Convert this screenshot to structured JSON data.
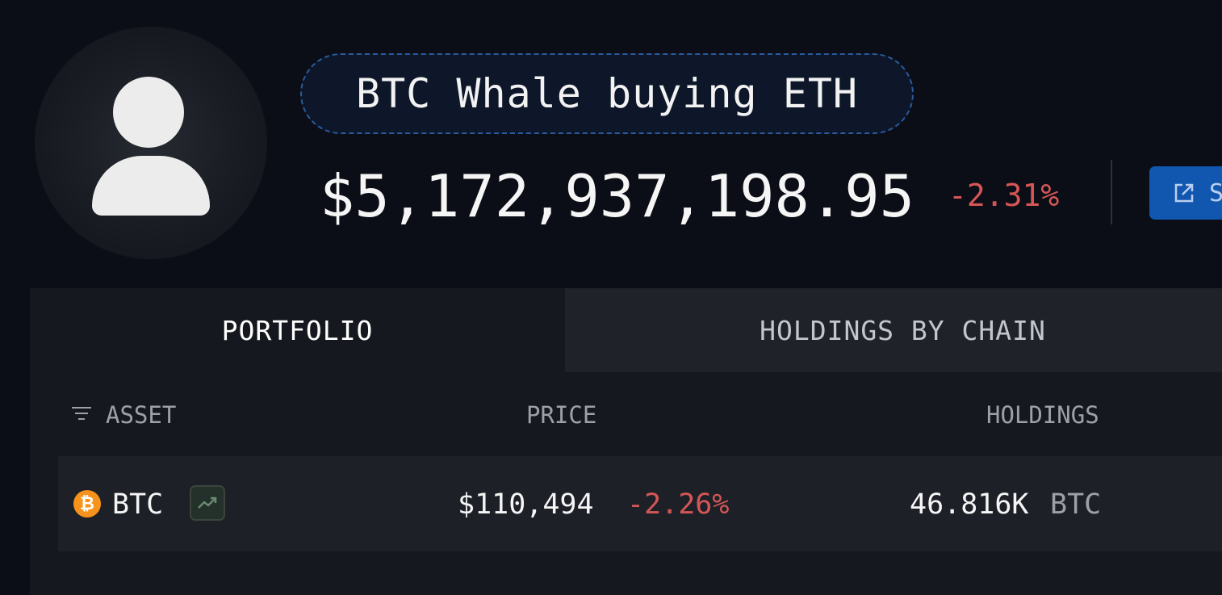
{
  "wallet": {
    "name": "BTC Whale buying ETH",
    "balance": "$5,172,937,198.95",
    "change": "-2.31%",
    "share_label": "S"
  },
  "tabs": [
    {
      "label": "PORTFOLIO",
      "active": true
    },
    {
      "label": "HOLDINGS BY CHAIN",
      "active": false
    }
  ],
  "table": {
    "headers": {
      "asset": "ASSET",
      "price": "PRICE",
      "holdings": "HOLDINGS"
    },
    "rows": [
      {
        "symbol": "BTC",
        "icon_glyph": "₿",
        "price": "$110,494",
        "change": "-2.26%",
        "holdings": "46.816K",
        "unit": "BTC"
      }
    ]
  },
  "colors": {
    "background": "#0b0e16",
    "negative": "#d45656",
    "accent": "#1157b0",
    "btc": "#f7931a",
    "trend": "#6b8a72"
  },
  "icons": [
    "user-avatar-icon",
    "external-link-icon",
    "filter-icon",
    "bitcoin-icon",
    "trending-up-icon"
  ]
}
